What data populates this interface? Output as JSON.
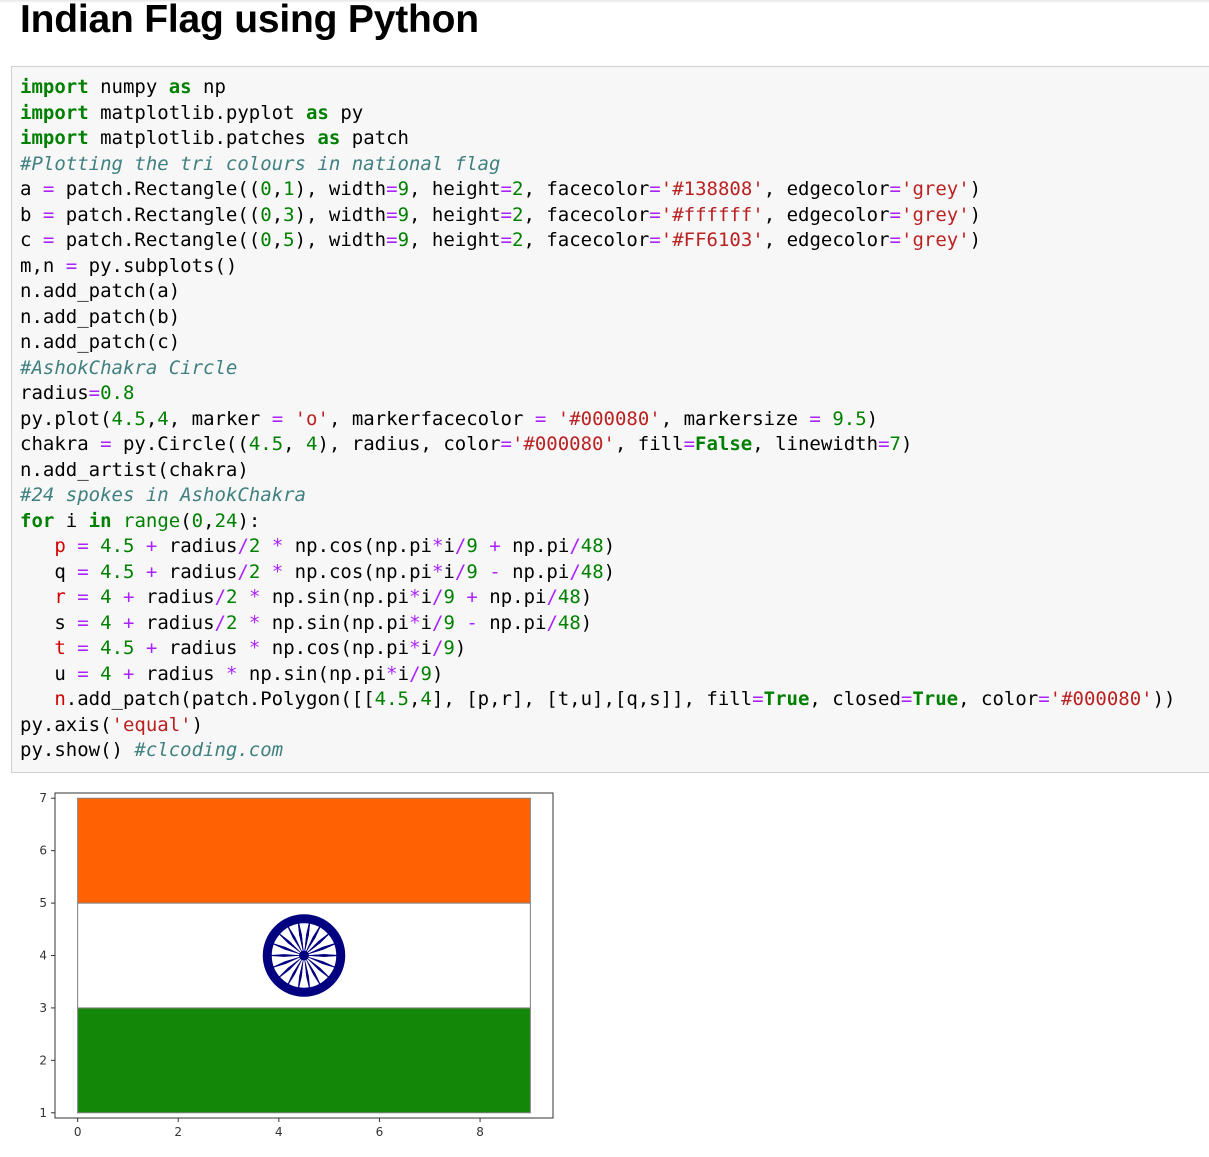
{
  "page": {
    "title": "Indian Flag using Python"
  },
  "code_lines": [
    [
      [
        "kw",
        "import"
      ],
      [
        "plain",
        " numpy "
      ],
      [
        "kw",
        "as"
      ],
      [
        "plain",
        " np"
      ]
    ],
    [
      [
        "kw",
        "import"
      ],
      [
        "plain",
        " matplotlib.pyplot "
      ],
      [
        "kw",
        "as"
      ],
      [
        "plain",
        " py"
      ]
    ],
    [
      [
        "kw",
        "import"
      ],
      [
        "plain",
        " matplotlib.patches "
      ],
      [
        "kw",
        "as"
      ],
      [
        "plain",
        " patch"
      ]
    ],
    [
      [
        "com",
        "#Plotting the tri colours in national flag"
      ]
    ],
    [
      [
        "plain",
        "a "
      ],
      [
        "op",
        "="
      ],
      [
        "plain",
        " patch.Rectangle(("
      ],
      [
        "num",
        "0"
      ],
      [
        "plain",
        ","
      ],
      [
        "num",
        "1"
      ],
      [
        "plain",
        "), width"
      ],
      [
        "op",
        "="
      ],
      [
        "num",
        "9"
      ],
      [
        "plain",
        ", height"
      ],
      [
        "op",
        "="
      ],
      [
        "num",
        "2"
      ],
      [
        "plain",
        ", facecolor"
      ],
      [
        "op",
        "="
      ],
      [
        "str",
        "'#138808'"
      ],
      [
        "plain",
        ", edgecolor"
      ],
      [
        "op",
        "="
      ],
      [
        "str",
        "'grey'"
      ],
      [
        "plain",
        ")"
      ]
    ],
    [
      [
        "plain",
        "b "
      ],
      [
        "op",
        "="
      ],
      [
        "plain",
        " patch.Rectangle(("
      ],
      [
        "num",
        "0"
      ],
      [
        "plain",
        ","
      ],
      [
        "num",
        "3"
      ],
      [
        "plain",
        "), width"
      ],
      [
        "op",
        "="
      ],
      [
        "num",
        "9"
      ],
      [
        "plain",
        ", height"
      ],
      [
        "op",
        "="
      ],
      [
        "num",
        "2"
      ],
      [
        "plain",
        ", facecolor"
      ],
      [
        "op",
        "="
      ],
      [
        "str",
        "'#ffffff'"
      ],
      [
        "plain",
        ", edgecolor"
      ],
      [
        "op",
        "="
      ],
      [
        "str",
        "'grey'"
      ],
      [
        "plain",
        ")"
      ]
    ],
    [
      [
        "plain",
        "c "
      ],
      [
        "op",
        "="
      ],
      [
        "plain",
        " patch.Rectangle(("
      ],
      [
        "num",
        "0"
      ],
      [
        "plain",
        ","
      ],
      [
        "num",
        "5"
      ],
      [
        "plain",
        "), width"
      ],
      [
        "op",
        "="
      ],
      [
        "num",
        "9"
      ],
      [
        "plain",
        ", height"
      ],
      [
        "op",
        "="
      ],
      [
        "num",
        "2"
      ],
      [
        "plain",
        ", facecolor"
      ],
      [
        "op",
        "="
      ],
      [
        "str",
        "'#FF6103'"
      ],
      [
        "plain",
        ", edgecolor"
      ],
      [
        "op",
        "="
      ],
      [
        "str",
        "'grey'"
      ],
      [
        "plain",
        ")"
      ]
    ],
    [
      [
        "plain",
        "m,n "
      ],
      [
        "op",
        "="
      ],
      [
        "plain",
        " py.subplots()"
      ]
    ],
    [
      [
        "plain",
        "n.add_patch(a)"
      ]
    ],
    [
      [
        "plain",
        "n.add_patch(b)"
      ]
    ],
    [
      [
        "plain",
        "n.add_patch(c)"
      ]
    ],
    [
      [
        "com",
        "#AshokChakra Circle"
      ]
    ],
    [
      [
        "plain",
        "radius"
      ],
      [
        "op",
        "="
      ],
      [
        "num",
        "0.8"
      ]
    ],
    [
      [
        "plain",
        "py.plot("
      ],
      [
        "num",
        "4.5"
      ],
      [
        "plain",
        ","
      ],
      [
        "num",
        "4"
      ],
      [
        "plain",
        ", marker "
      ],
      [
        "op",
        "="
      ],
      [
        "plain",
        " "
      ],
      [
        "str",
        "'o'"
      ],
      [
        "plain",
        ", markerfacecolor "
      ],
      [
        "op",
        "="
      ],
      [
        "plain",
        " "
      ],
      [
        "str",
        "'#000080'"
      ],
      [
        "plain",
        ", markersize "
      ],
      [
        "op",
        "="
      ],
      [
        "plain",
        " "
      ],
      [
        "num",
        "9.5"
      ],
      [
        "plain",
        ")"
      ]
    ],
    [
      [
        "plain",
        "chakra "
      ],
      [
        "op",
        "="
      ],
      [
        "plain",
        " py.Circle(("
      ],
      [
        "num",
        "4.5"
      ],
      [
        "plain",
        ", "
      ],
      [
        "num",
        "4"
      ],
      [
        "plain",
        "), radius, color"
      ],
      [
        "op",
        "="
      ],
      [
        "str",
        "'#000080'"
      ],
      [
        "plain",
        ", fill"
      ],
      [
        "op",
        "="
      ],
      [
        "kw",
        "False"
      ],
      [
        "plain",
        ", linewidth"
      ],
      [
        "op",
        "="
      ],
      [
        "num",
        "7"
      ],
      [
        "plain",
        ")"
      ]
    ],
    [
      [
        "plain",
        "n.add_artist(chakra)"
      ]
    ],
    [
      [
        "com",
        "#24 spokes in AshokChakra"
      ]
    ],
    [
      [
        "kw",
        "for"
      ],
      [
        "plain",
        " i "
      ],
      [
        "kw",
        "in"
      ],
      [
        "plain",
        " "
      ],
      [
        "num",
        "range"
      ],
      [
        "plain",
        "("
      ],
      [
        "num",
        "0"
      ],
      [
        "plain",
        ","
      ],
      [
        "num",
        "24"
      ],
      [
        "plain",
        "):"
      ]
    ],
    [
      [
        "plain",
        "   "
      ],
      [
        "var",
        "p"
      ],
      [
        "plain",
        " "
      ],
      [
        "op",
        "="
      ],
      [
        "plain",
        " "
      ],
      [
        "num",
        "4.5"
      ],
      [
        "plain",
        " "
      ],
      [
        "op",
        "+"
      ],
      [
        "plain",
        " radius"
      ],
      [
        "op",
        "/"
      ],
      [
        "num",
        "2"
      ],
      [
        "plain",
        " "
      ],
      [
        "op",
        "*"
      ],
      [
        "plain",
        " np.cos(np.pi"
      ],
      [
        "op",
        "*"
      ],
      [
        "plain",
        "i"
      ],
      [
        "op",
        "/"
      ],
      [
        "num",
        "9"
      ],
      [
        "plain",
        " "
      ],
      [
        "op",
        "+"
      ],
      [
        "plain",
        " np.pi"
      ],
      [
        "op",
        "/"
      ],
      [
        "num",
        "48"
      ],
      [
        "plain",
        ")"
      ]
    ],
    [
      [
        "plain",
        "   q "
      ],
      [
        "op",
        "="
      ],
      [
        "plain",
        " "
      ],
      [
        "num",
        "4.5"
      ],
      [
        "plain",
        " "
      ],
      [
        "op",
        "+"
      ],
      [
        "plain",
        " radius"
      ],
      [
        "op",
        "/"
      ],
      [
        "num",
        "2"
      ],
      [
        "plain",
        " "
      ],
      [
        "op",
        "*"
      ],
      [
        "plain",
        " np.cos(np.pi"
      ],
      [
        "op",
        "*"
      ],
      [
        "plain",
        "i"
      ],
      [
        "op",
        "/"
      ],
      [
        "num",
        "9"
      ],
      [
        "plain",
        " "
      ],
      [
        "op",
        "-"
      ],
      [
        "plain",
        " np.pi"
      ],
      [
        "op",
        "/"
      ],
      [
        "num",
        "48"
      ],
      [
        "plain",
        ")"
      ]
    ],
    [
      [
        "plain",
        "   "
      ],
      [
        "var",
        "r"
      ],
      [
        "plain",
        " "
      ],
      [
        "op",
        "="
      ],
      [
        "plain",
        " "
      ],
      [
        "num",
        "4"
      ],
      [
        "plain",
        " "
      ],
      [
        "op",
        "+"
      ],
      [
        "plain",
        " radius"
      ],
      [
        "op",
        "/"
      ],
      [
        "num",
        "2"
      ],
      [
        "plain",
        " "
      ],
      [
        "op",
        "*"
      ],
      [
        "plain",
        " np.sin(np.pi"
      ],
      [
        "op",
        "*"
      ],
      [
        "plain",
        "i"
      ],
      [
        "op",
        "/"
      ],
      [
        "num",
        "9"
      ],
      [
        "plain",
        " "
      ],
      [
        "op",
        "+"
      ],
      [
        "plain",
        " np.pi"
      ],
      [
        "op",
        "/"
      ],
      [
        "num",
        "48"
      ],
      [
        "plain",
        ")"
      ]
    ],
    [
      [
        "plain",
        "   s "
      ],
      [
        "op",
        "="
      ],
      [
        "plain",
        " "
      ],
      [
        "num",
        "4"
      ],
      [
        "plain",
        " "
      ],
      [
        "op",
        "+"
      ],
      [
        "plain",
        " radius"
      ],
      [
        "op",
        "/"
      ],
      [
        "num",
        "2"
      ],
      [
        "plain",
        " "
      ],
      [
        "op",
        "*"
      ],
      [
        "plain",
        " np.sin(np.pi"
      ],
      [
        "op",
        "*"
      ],
      [
        "plain",
        "i"
      ],
      [
        "op",
        "/"
      ],
      [
        "num",
        "9"
      ],
      [
        "plain",
        " "
      ],
      [
        "op",
        "-"
      ],
      [
        "plain",
        " np.pi"
      ],
      [
        "op",
        "/"
      ],
      [
        "num",
        "48"
      ],
      [
        "plain",
        ")"
      ]
    ],
    [
      [
        "plain",
        "   "
      ],
      [
        "var",
        "t"
      ],
      [
        "plain",
        " "
      ],
      [
        "op",
        "="
      ],
      [
        "plain",
        " "
      ],
      [
        "num",
        "4.5"
      ],
      [
        "plain",
        " "
      ],
      [
        "op",
        "+"
      ],
      [
        "plain",
        " radius "
      ],
      [
        "op",
        "*"
      ],
      [
        "plain",
        " np.cos(np.pi"
      ],
      [
        "op",
        "*"
      ],
      [
        "plain",
        "i"
      ],
      [
        "op",
        "/"
      ],
      [
        "num",
        "9"
      ],
      [
        "plain",
        ")"
      ]
    ],
    [
      [
        "plain",
        "   u "
      ],
      [
        "op",
        "="
      ],
      [
        "plain",
        " "
      ],
      [
        "num",
        "4"
      ],
      [
        "plain",
        " "
      ],
      [
        "op",
        "+"
      ],
      [
        "plain",
        " radius "
      ],
      [
        "op",
        "*"
      ],
      [
        "plain",
        " np.sin(np.pi"
      ],
      [
        "op",
        "*"
      ],
      [
        "plain",
        "i"
      ],
      [
        "op",
        "/"
      ],
      [
        "num",
        "9"
      ],
      [
        "plain",
        ")"
      ]
    ],
    [
      [
        "plain",
        "   "
      ],
      [
        "var",
        "n"
      ],
      [
        "plain",
        ".add_patch(patch.Polygon([["
      ],
      [
        "num",
        "4.5"
      ],
      [
        "plain",
        ","
      ],
      [
        "num",
        "4"
      ],
      [
        "plain",
        "], [p,r], [t,u],[q,s]], fill"
      ],
      [
        "op",
        "="
      ],
      [
        "kw",
        "True"
      ],
      [
        "plain",
        ", closed"
      ],
      [
        "op",
        "="
      ],
      [
        "kw",
        "True"
      ],
      [
        "plain",
        ", color"
      ],
      [
        "op",
        "="
      ],
      [
        "str",
        "'#000080'"
      ],
      [
        "plain",
        "))"
      ]
    ],
    [
      [
        "plain",
        "py.axis("
      ],
      [
        "str",
        "'equal'"
      ],
      [
        "plain",
        ")"
      ]
    ],
    [
      [
        "plain",
        "py.show() "
      ],
      [
        "com",
        "#clcoding.com"
      ]
    ]
  ],
  "chart_data": {
    "type": "patches",
    "xlim": [
      -0.45,
      9.45
    ],
    "ylim": [
      0.9,
      7.1
    ],
    "xticks": [
      0,
      2,
      4,
      6,
      8
    ],
    "yticks": [
      1,
      2,
      3,
      4,
      5,
      6,
      7
    ],
    "xtick_labels": [
      "0",
      "2",
      "4",
      "6",
      "8"
    ],
    "ytick_labels": [
      "1",
      "2",
      "3",
      "4",
      "5",
      "6",
      "7"
    ],
    "rectangles": [
      {
        "x": 0,
        "y": 1,
        "width": 9,
        "height": 2,
        "facecolor": "#138808",
        "edgecolor": "grey"
      },
      {
        "x": 0,
        "y": 3,
        "width": 9,
        "height": 2,
        "facecolor": "#ffffff",
        "edgecolor": "grey"
      },
      {
        "x": 0,
        "y": 5,
        "width": 9,
        "height": 2,
        "facecolor": "#FF6103",
        "edgecolor": "grey"
      }
    ],
    "chakra": {
      "cx": 4.5,
      "cy": 4,
      "radius": 0.8,
      "color": "#000080",
      "spokes": 24
    }
  }
}
